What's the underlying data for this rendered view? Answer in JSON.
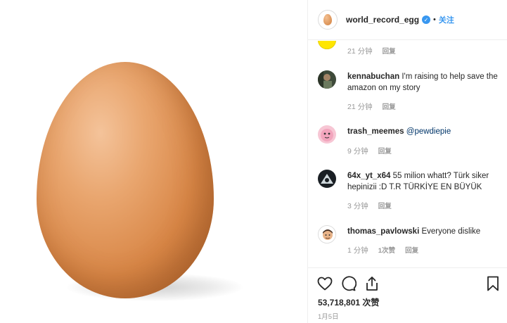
{
  "post": {
    "username": "world_record_egg",
    "follow_label": "关注",
    "separator": "•"
  },
  "comments": [
    {
      "user": "",
      "text": "",
      "time": "21 分钟",
      "reply": "回复",
      "avatar": "yellow-avatar"
    },
    {
      "user": "kennabuchan",
      "text": "I'm raising to help save the amazon on my story",
      "time": "21 分钟",
      "reply": "回复",
      "avatar": "photo-avatar"
    },
    {
      "user": "trash_meemes",
      "mention": "@pewdiepie",
      "time": "9 分钟",
      "reply": "回复",
      "avatar": "pink-cartoon-avatar"
    },
    {
      "user": "64x_yt_x64",
      "text": "55 milion whatt? Türk siker hepinizii :D T.R TÜRKİYE EN BÜYÜK",
      "time": "3 分钟",
      "reply": "回复",
      "avatar": "dark-avatar"
    },
    {
      "user": "thomas_pavlowski",
      "text": "Everyone dislike",
      "time": "1 分钟",
      "likes": "1次赞",
      "reply": "回复",
      "avatar": "cartoon-man-avatar"
    }
  ],
  "footer": {
    "likes": "53,718,801 次赞",
    "date": "1月5日",
    "icons": [
      "heart-icon",
      "comment-icon",
      "share-icon",
      "bookmark-icon"
    ]
  },
  "colors": {
    "accent": "#3897f0",
    "text": "#262626",
    "muted": "#999999",
    "border": "#efefef"
  }
}
